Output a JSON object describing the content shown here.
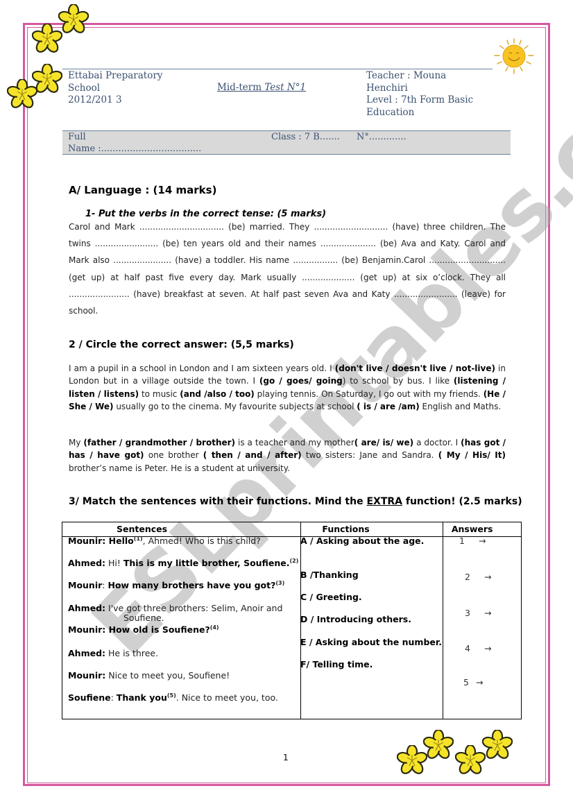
{
  "header": {
    "school_line1": "Ettabai Preparatory",
    "school_line2": "School",
    "year": "2012/201 3",
    "test_title_part1": "Mid-term ",
    "test_title_part2": "Test N°1",
    "teacher_line1": "Teacher : Mouna",
    "teacher_line2": "Henchiri",
    "level_line1": "Level : 7th Form Basic",
    "level_line2": "Education"
  },
  "name_box": {
    "full_label": "Full",
    "name_label": "Name :...................................",
    "class_label": "Class : 7 B.......",
    "number_label": "N°............."
  },
  "section_a": {
    "title": "A/ Language : (14 marks)",
    "q1": {
      "title": "1-  Put the verbs in the correct tense: (5 marks)",
      "text": "Carol and Mark ................................ (be) married. They ............................ (have) three children. The twins ........................ (be) ten years old and their names ..................... (be) Ava and Katy. Carol and Mark also ...................... (have) a toddler. His name ................. (be) Benjamin.Carol ............................. (get up) at half past five every day. Mark usually .................... (get up) at six o’clock. They all ....................... (have) breakfast at seven. At half past seven Ava and Katy ........................ (leave) for school."
    },
    "q2": {
      "title": "2 / Circle the correct answer: (5,5 marks)",
      "p1": [
        {
          "t": " I am a pupil in a school in London and I am sixteen years old. I ",
          "b": false
        },
        {
          "t": "(don't live / doesn't live / not-live)",
          "b": true
        },
        {
          "t": " in London but in a village outside the town. I ",
          "b": false
        },
        {
          "t": "(go / goes/ going",
          "b": true
        },
        {
          "t": ") to school by bus. I like ",
          "b": false
        },
        {
          "t": "(listening / listen / listens)",
          "b": true
        },
        {
          "t": " to music ",
          "b": false
        },
        {
          "t": "(and /also / too)",
          "b": true
        },
        {
          "t": " playing tennis. On Saturday, I go out with my friends. ",
          "b": false
        },
        {
          "t": "(He / She / We)",
          "b": true
        },
        {
          "t": " usually go to the cinema. My favourite subjects at school ",
          "b": false
        },
        {
          "t": "( is / are /am)",
          "b": true
        },
        {
          "t": " English and Maths.",
          "b": false
        }
      ],
      "p2": [
        {
          "t": "My ",
          "b": false
        },
        {
          "t": "(father / grandmother / brother)",
          "b": true
        },
        {
          "t": " is a teacher and my mother",
          "b": false
        },
        {
          "t": "( are/ is/ we)",
          "b": true
        },
        {
          "t": " a doctor. I ",
          "b": false
        },
        {
          "t": "(has got / has / have got)",
          "b": true
        },
        {
          "t": " one brother ",
          "b": false
        },
        {
          "t": "( then / and / after)",
          "b": true
        },
        {
          "t": " two sisters: Jane and Sandra. ",
          "b": false
        },
        {
          "t": "( My / His/ It)",
          "b": true
        },
        {
          "t": " brother’s name is Peter. He is a student at university.",
          "b": false
        }
      ]
    },
    "q3": {
      "title_part1": "3/ Match the sentences with their functions. Mind the ",
      "title_extra": "EXTRA",
      "title_part2": " function! (2.5 marks)",
      "columns": [
        "Sentences",
        "Functions",
        "Answers"
      ],
      "sentences": [
        {
          "speaker": "Mounir:",
          "bold": " Hello",
          "sup": "(1)",
          "rest": ", Ahmed! Who is this child?"
        },
        {
          "speaker": "Ahmed:",
          "plain": " Hi! ",
          "bold": "This is my little brother, Soufiene.",
          "sup": "(2)",
          "rest": ""
        },
        {
          "speaker": " Mounir",
          "plain": ": ",
          "bold": "How many brothers have you got?",
          "sup": "(3)",
          "rest": ""
        },
        {
          "speaker": "Ahmed:",
          "rest": " I've got three brothers: Selim, Anoir and",
          "cont": "Soufiene."
        },
        {
          "speaker": "Mounir:",
          "bold": " How old is Soufiene?",
          "sup": "(4)",
          "rest": ""
        },
        {
          "speaker": "Ahmed:",
          "rest": " He is three."
        },
        {
          "speaker": "Mounir:",
          "rest": " Nice to meet you, Soufiene!"
        },
        {
          "speaker": "Soufiene",
          "plain": ": ",
          "bold": "Thank you",
          "sup": "(5)",
          "rest": ".  Nice to meet you, too."
        }
      ],
      "functions": [
        "A / Asking about the age.",
        "B /Thanking",
        "C / Greeting.",
        "D / Introducing others.",
        "E / Asking about the number.",
        "F/ Telling time."
      ],
      "answers": [
        "1",
        "2",
        "3",
        "4",
        "5"
      ],
      "arrow": "→"
    }
  },
  "watermark": "ESLprintables.com",
  "page_number": "1",
  "colors": {
    "border": "#d4589f",
    "header_text": "#3a5070",
    "name_box_bg": "#d9d9d9",
    "flower": "#f5e32a"
  }
}
